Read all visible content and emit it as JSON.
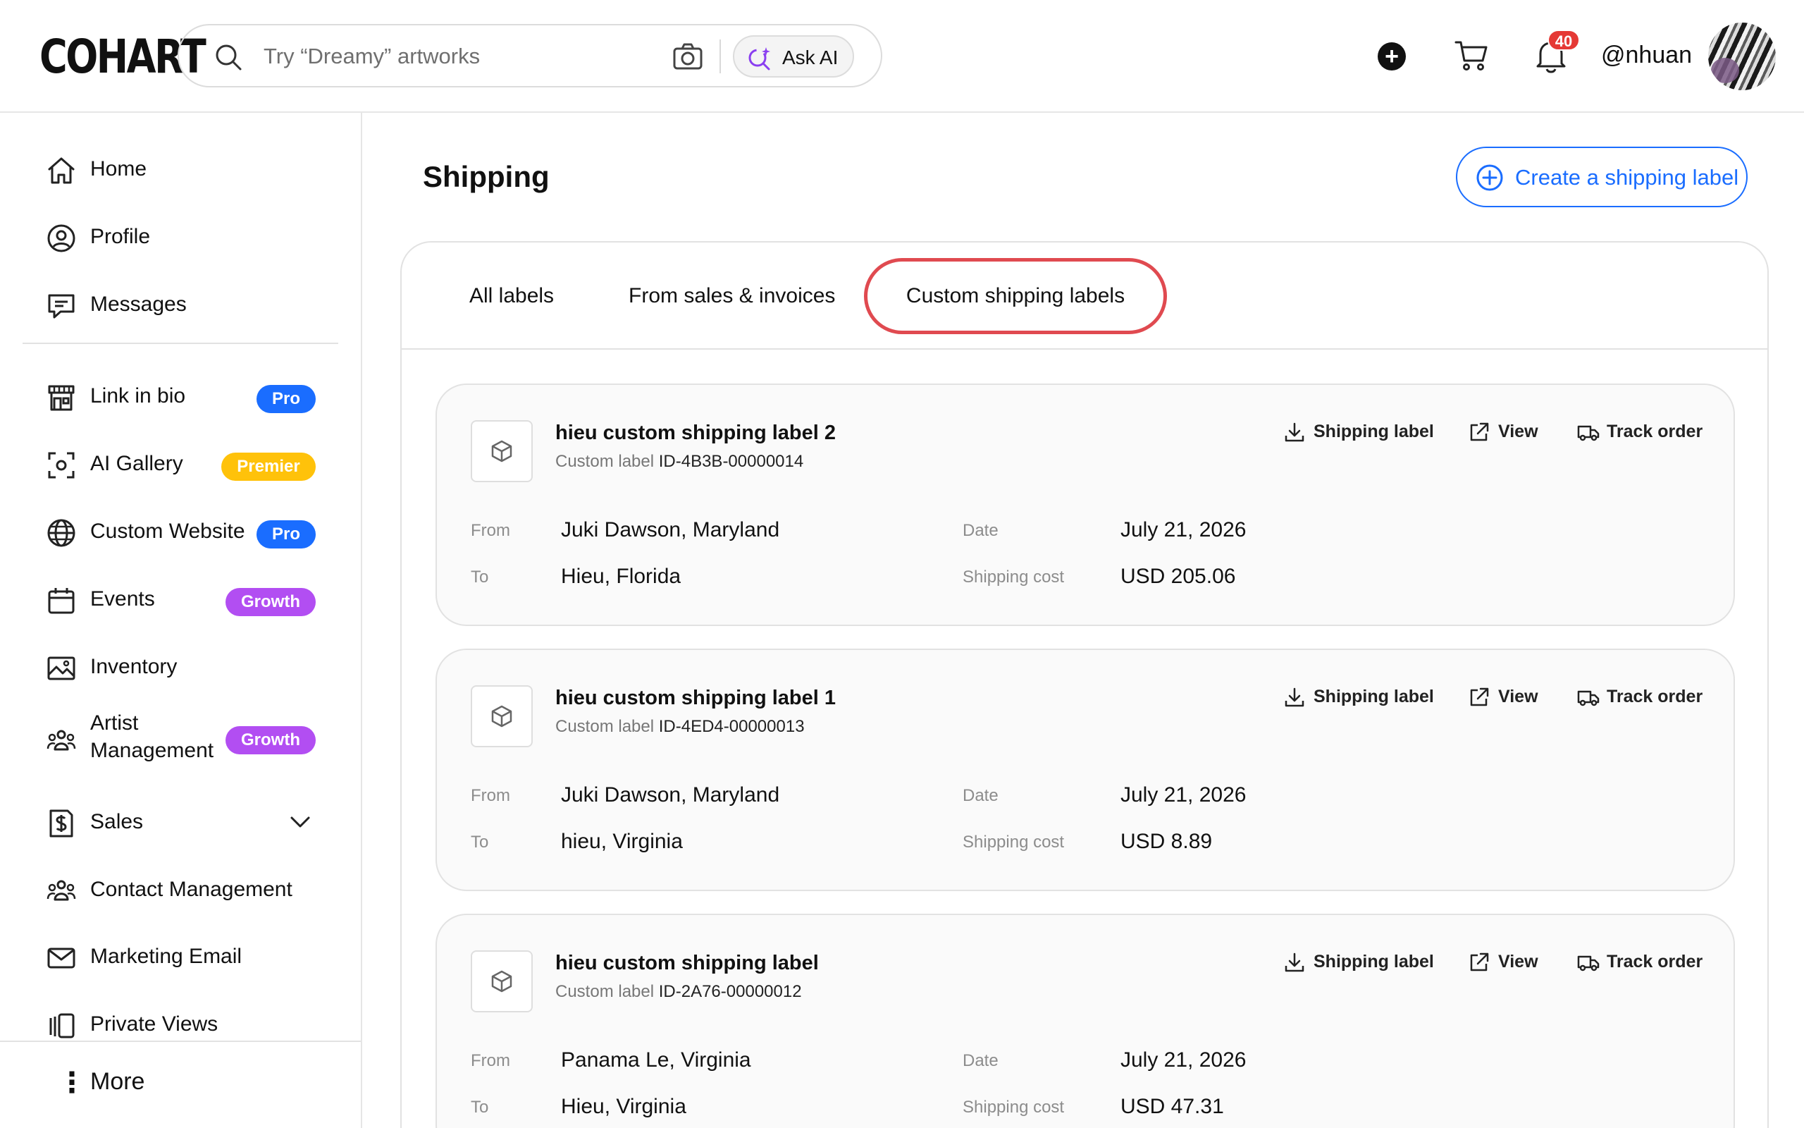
{
  "app": {
    "logo": "COHART"
  },
  "search": {
    "placeholder": "Try “Dreamy” artworks",
    "ask_ai_label": "Ask AI"
  },
  "header": {
    "notification_count": "40",
    "username": "@nhuan"
  },
  "sidebar": {
    "items": [
      {
        "label": "Home",
        "icon": "home-icon"
      },
      {
        "label": "Profile",
        "icon": "user-circle-icon"
      },
      {
        "label": "Messages",
        "icon": "message-icon"
      },
      {
        "label": "Link in bio",
        "icon": "storefront-icon",
        "badge": "Pro"
      },
      {
        "label": "AI Gallery",
        "icon": "scan-icon",
        "badge": "Premier"
      },
      {
        "label": "Custom Website",
        "icon": "globe-icon",
        "badge": "Pro"
      },
      {
        "label": "Events",
        "icon": "calendar-icon",
        "badge": "Growth"
      },
      {
        "label": "Inventory",
        "icon": "image-icon"
      },
      {
        "label_line1": "Artist",
        "label_line2": "Management",
        "icon": "users-icon",
        "badge": "Growth"
      },
      {
        "label": "Sales",
        "icon": "dollar-icon"
      },
      {
        "label": "Contact Management",
        "icon": "contacts-icon"
      },
      {
        "label": "Marketing Email",
        "icon": "mail-icon"
      },
      {
        "label": "Private Views",
        "icon": "gallery-icon"
      }
    ],
    "more_label": "More"
  },
  "main": {
    "title": "Shipping",
    "create_button": "Create a shipping label",
    "tabs": [
      {
        "label": "All labels",
        "active": false
      },
      {
        "label": "From sales & invoices",
        "active": false
      },
      {
        "label": "Custom shipping labels",
        "active": true
      }
    ],
    "actions": {
      "download": "Shipping label",
      "view": "View",
      "track": "Track order"
    },
    "field_labels": {
      "from": "From",
      "to": "To",
      "date": "Date",
      "cost": "Shipping cost"
    },
    "subtitle_prefix": "Custom label",
    "labels": [
      {
        "name": "hieu custom shipping label 2",
        "id": "ID-4B3B-00000014",
        "from": "Juki Dawson, Maryland",
        "to": "Hieu, Florida",
        "date": "July 21, 2026",
        "cost": "USD 205.06"
      },
      {
        "name": "hieu custom shipping label 1",
        "id": "ID-4ED4-00000013",
        "from": "Juki Dawson, Maryland",
        "to": "hieu, Virginia",
        "date": "July 21, 2026",
        "cost": "USD 8.89"
      },
      {
        "name": "hieu custom shipping label",
        "id": "ID-2A76-00000012",
        "from": "Panama Le, Virginia",
        "to": "Hieu, Virginia",
        "date": "July 21, 2026",
        "cost": "USD 47.31"
      }
    ]
  },
  "colors": {
    "accent": "#1a6dff",
    "pro": "#1a6dff",
    "premier": "#ffc20a",
    "growth": "#b24ef2",
    "alert": "#e53935",
    "highlight_ring": "#e04a50"
  }
}
